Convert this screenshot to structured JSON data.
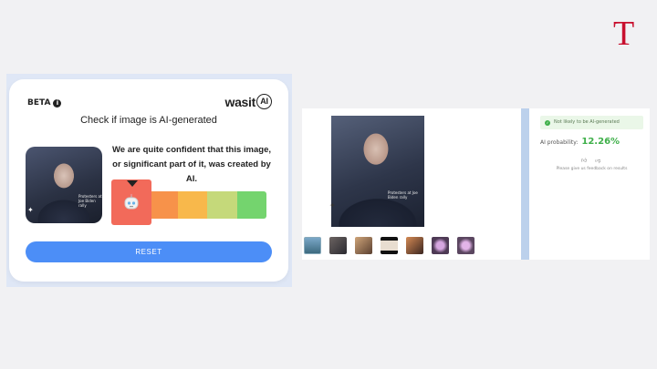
{
  "brand": {
    "mark": "T",
    "color": "#c8102e"
  },
  "detector_card": {
    "beta_label": "BETA",
    "info_icon": "info-icon",
    "logo_text": "wasit",
    "logo_ai": "AI",
    "title": "Check if image is AI-generated",
    "thumbnail_caption": "Protesters at Joe Biden rally",
    "verdict_text": "We are quite confident that this image, or significant part of it, was created by AI.",
    "meter_colors": [
      "#f26a5a",
      "#f7924a",
      "#f8b84b",
      "#c5d97a",
      "#74d46e"
    ],
    "meter_level_segment": 1,
    "marker_icon": "robot-icon",
    "reset_label": "RESET",
    "accent_color": "#4c8ef7"
  },
  "screenshot_panel": {
    "photo_caption": "Protesters at Joe Biden rally",
    "thumbnail_count": 7,
    "result_badge": "Not likely to be AI-generated",
    "probability_label": "AI probability:",
    "probability_value": "12.26%",
    "feedback_text": "Please give us feedback on results",
    "thumbs_up_icon": "thumbs-up-icon",
    "thumbs_down_icon": "thumbs-down-icon",
    "result_color": "#3fb04a"
  }
}
